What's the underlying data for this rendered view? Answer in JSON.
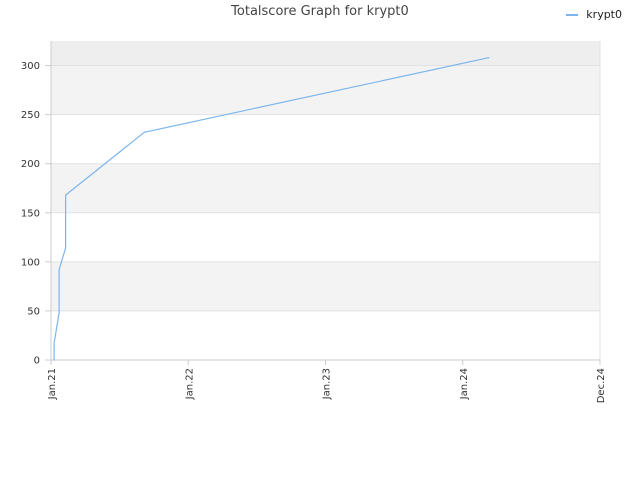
{
  "chart_data": {
    "type": "line",
    "title": "Totalscore Graph for krypt0",
    "xlabel": "",
    "ylabel": "",
    "grid": true,
    "legend_placement": "top-right",
    "x_ticks": [
      "Jan.21",
      "Jan.22",
      "Jan.23",
      "Jan.24",
      "Dec.24"
    ],
    "x_range": [
      "2021-01-01",
      "2024-12-01"
    ],
    "y_ticks": [
      0,
      50,
      100,
      150,
      200,
      250,
      300
    ],
    "ylim": [
      0,
      325
    ],
    "series": [
      {
        "name": "krypt0",
        "color": "#7cb5ec",
        "points": [
          {
            "x": "2021-01-09",
            "y": 0
          },
          {
            "x": "2021-01-09",
            "y": 17
          },
          {
            "x": "2021-01-22",
            "y": 48
          },
          {
            "x": "2021-01-22",
            "y": 92
          },
          {
            "x": "2021-02-08",
            "y": 114
          },
          {
            "x": "2021-02-08",
            "y": 168
          },
          {
            "x": "2021-09-01",
            "y": 232
          },
          {
            "x": "2024-02-15",
            "y": 308
          }
        ]
      }
    ]
  }
}
